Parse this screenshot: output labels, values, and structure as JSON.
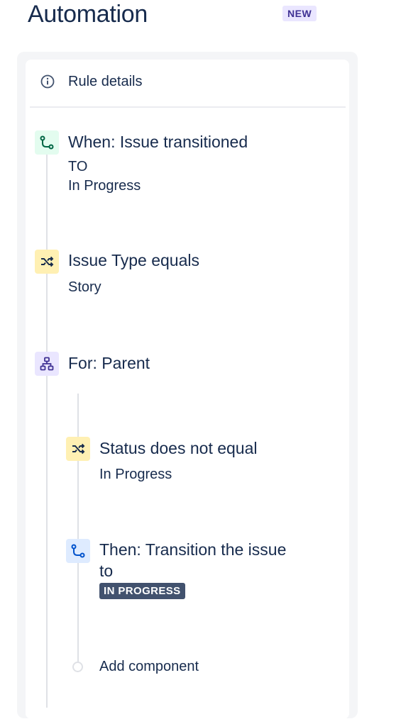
{
  "header": {
    "title": "Automation",
    "badge": "NEW"
  },
  "panel": {
    "rule_details_label": "Rule details"
  },
  "steps": [
    {
      "type": "trigger",
      "icon": "branch-icon",
      "title": "When: Issue transitioned",
      "line2": "TO",
      "detail": "In Progress",
      "accent": "#E3FCEF"
    },
    {
      "type": "condition",
      "icon": "shuffle-icon",
      "title": "Issue Type equals",
      "detail": "Story",
      "accent": "#FFF0B3"
    },
    {
      "type": "branch",
      "icon": "hierarchy-icon",
      "title": "For: Parent",
      "accent": "#EAE6FF"
    },
    {
      "type": "condition",
      "icon": "shuffle-icon",
      "title": "Status does not equal",
      "detail": "In Progress",
      "accent": "#FFF0B3"
    },
    {
      "type": "action",
      "icon": "branch-icon",
      "title": "Then: Transition the issue",
      "line2": "to",
      "lozenge": "IN PROGRESS",
      "accent": "#DEEBFF"
    }
  ],
  "add_component_label": "Add component"
}
